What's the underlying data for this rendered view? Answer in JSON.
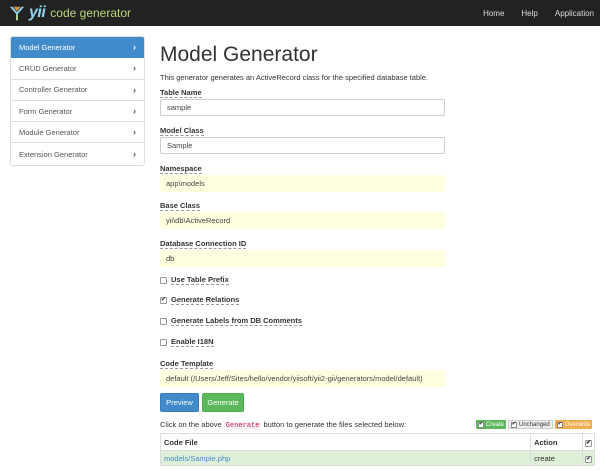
{
  "brand": {
    "logo_text": "yii",
    "subtitle": "code generator"
  },
  "nav": {
    "items": [
      "Home",
      "Help",
      "Application"
    ]
  },
  "sidebar": {
    "items": [
      {
        "label": "Model Generator",
        "active": true
      },
      {
        "label": "CRUD Generator",
        "active": false
      },
      {
        "label": "Controller Generator",
        "active": false
      },
      {
        "label": "Form Generator",
        "active": false
      },
      {
        "label": "Module Generator",
        "active": false
      },
      {
        "label": "Extension Generator",
        "active": false
      }
    ]
  },
  "main": {
    "title": "Model Generator",
    "description": "This generator generates an ActiveRecord class for the specified database table.",
    "fields": {
      "table_name": {
        "label": "Table Name",
        "value": "sample"
      },
      "model_class": {
        "label": "Model Class",
        "value": "Sample"
      },
      "namespace": {
        "label": "Namespace",
        "value": "app\\models"
      },
      "base_class": {
        "label": "Base Class",
        "value": "yii\\db\\ActiveRecord"
      },
      "db": {
        "label": "Database Connection ID",
        "value": "db"
      },
      "code_template": {
        "label": "Code Template",
        "value": "default (/Users/Jeff/Sites/hello/vendor/yiisoft/yii2-gii/generators/model/default)"
      }
    },
    "checkboxes": {
      "table_prefix": {
        "label": "Use Table Prefix",
        "checked": false
      },
      "relations": {
        "label": "Generate Relations",
        "checked": true
      },
      "labels_db": {
        "label": "Generate Labels from DB Comments",
        "checked": false
      },
      "i18n": {
        "label": "Enable I18N",
        "checked": false
      }
    },
    "buttons": {
      "preview": "Preview",
      "generate": "Generate"
    },
    "instructions": {
      "before": "Click on the above",
      "code": "Generate",
      "after": "button to generate the files selected below:"
    },
    "legend": {
      "create": "Create",
      "unchanged": "Unchanged",
      "overwrite": "Overwrite"
    },
    "table": {
      "headers": {
        "file": "Code File",
        "action": "Action"
      },
      "rows": [
        {
          "file": "models/Sample.php",
          "action": "create",
          "checked": true
        }
      ]
    }
  },
  "colors": {
    "primary": "#428bca",
    "success": "#5cb85c",
    "warning": "#f0ad4e",
    "sticky_bg": "#ffffe0",
    "row_bg": "#dff0d8"
  }
}
